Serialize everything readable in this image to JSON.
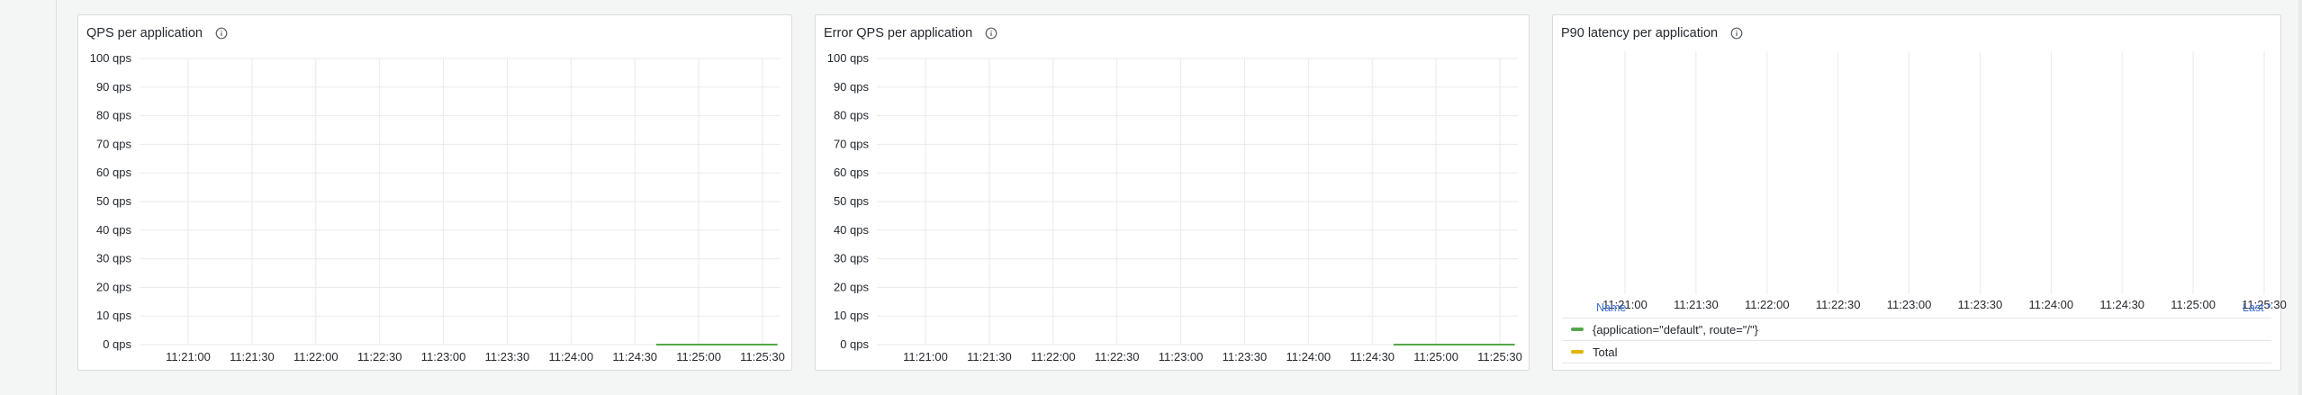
{
  "panels": [
    {
      "title": "QPS per application",
      "info_icon": "info-circle-icon",
      "chart_data": {
        "type": "line",
        "title": "QPS per application",
        "x": [
          "11:21:00",
          "11:21:30",
          "11:22:00",
          "11:22:30",
          "11:23:00",
          "11:23:30",
          "11:24:00",
          "11:24:30",
          "11:25:00",
          "11:25:30"
        ],
        "y_ticks": [
          "100 qps",
          "90 qps",
          "80 qps",
          "70 qps",
          "60 qps",
          "50 qps",
          "40 qps",
          "30 qps",
          "20 qps",
          "10 qps",
          "0 qps"
        ],
        "ylim": [
          0,
          100
        ],
        "grid": true,
        "series": [
          {
            "color": "#56a64b",
            "points": [
              [
                "11:24:40",
                0
              ],
              [
                "11:25:37",
                0
              ]
            ]
          }
        ]
      }
    },
    {
      "title": "Error QPS per application",
      "info_icon": "info-circle-icon",
      "chart_data": {
        "type": "line",
        "title": "Error QPS per application",
        "x": [
          "11:21:00",
          "11:21:30",
          "11:22:00",
          "11:22:30",
          "11:23:00",
          "11:23:30",
          "11:24:00",
          "11:24:30",
          "11:25:00",
          "11:25:30"
        ],
        "y_ticks": [
          "100 qps",
          "90 qps",
          "80 qps",
          "70 qps",
          "60 qps",
          "50 qps",
          "40 qps",
          "30 qps",
          "20 qps",
          "10 qps",
          "0 qps"
        ],
        "ylim": [
          0,
          100
        ],
        "grid": true,
        "series": [
          {
            "color": "#56a64b",
            "points": [
              [
                "11:24:40",
                0
              ],
              [
                "11:25:37",
                0
              ]
            ]
          }
        ]
      }
    },
    {
      "title": "P90 latency per application",
      "info_icon": "info-circle-icon",
      "chart_data": {
        "type": "line",
        "title": "P90 latency per application",
        "x": [
          "11:21:00",
          "11:21:30",
          "11:22:00",
          "11:22:30",
          "11:23:00",
          "11:23:30",
          "11:24:00",
          "11:24:30",
          "11:25:00",
          "11:25:30"
        ],
        "grid": true,
        "series": []
      },
      "legend": {
        "name_header": "Name",
        "last_header": "Last *",
        "rows": [
          {
            "label": "{application=\"default\", route=\"/\"}",
            "color": "#56a64b"
          },
          {
            "label": "Total",
            "color": "#e0b400"
          }
        ]
      }
    }
  ]
}
